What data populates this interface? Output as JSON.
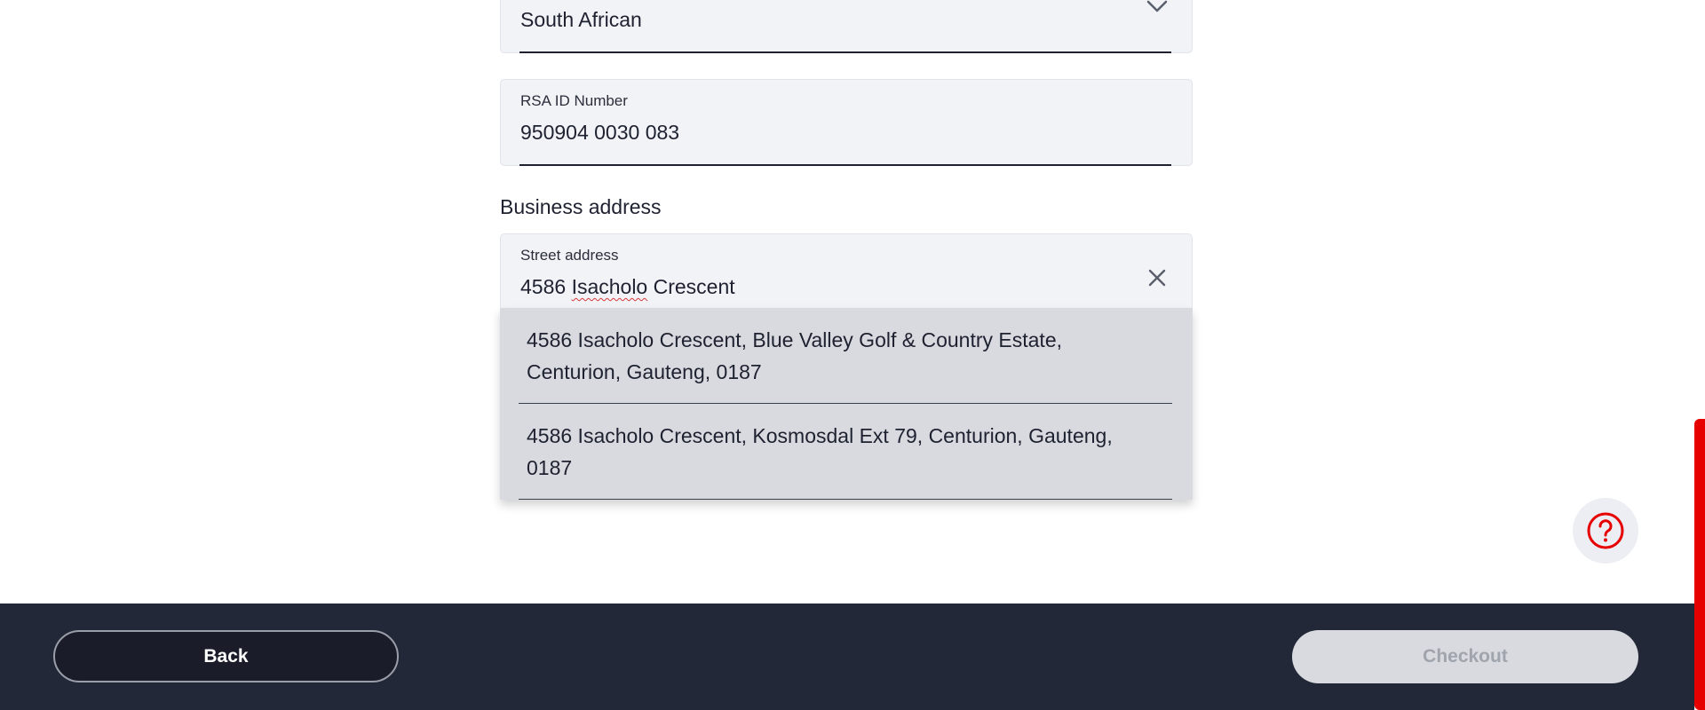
{
  "nationality": {
    "value": "South African",
    "icon": "chevron-down-icon"
  },
  "id_number": {
    "label": "RSA ID Number",
    "value": "950904 0030 083"
  },
  "business_address": {
    "section_title": "Business address",
    "street": {
      "label": "Street address",
      "value_prefix": "4586 ",
      "value_misspelled": "Isacholo",
      "value_suffix": " Crescent",
      "clear_icon": "close-icon"
    },
    "suggestions": [
      {
        "line1": "4586 Isacholo Crescent, Blue Valley Golf & Country Estate,",
        "line2": "Centurion, Gauteng, 0187"
      },
      {
        "line1": "4586 Isacholo Crescent, Kosmosdal Ext 79, Centurion, Gauteng,",
        "line2": "0187"
      }
    ]
  },
  "help": {
    "icon": "question-circle-icon",
    "color": "#e60000"
  },
  "footer": {
    "back_label": "Back",
    "checkout_label": "Checkout"
  },
  "colors": {
    "accent": "#e60000",
    "footer_bg": "#232838",
    "field_bg": "#f2f3f7"
  }
}
